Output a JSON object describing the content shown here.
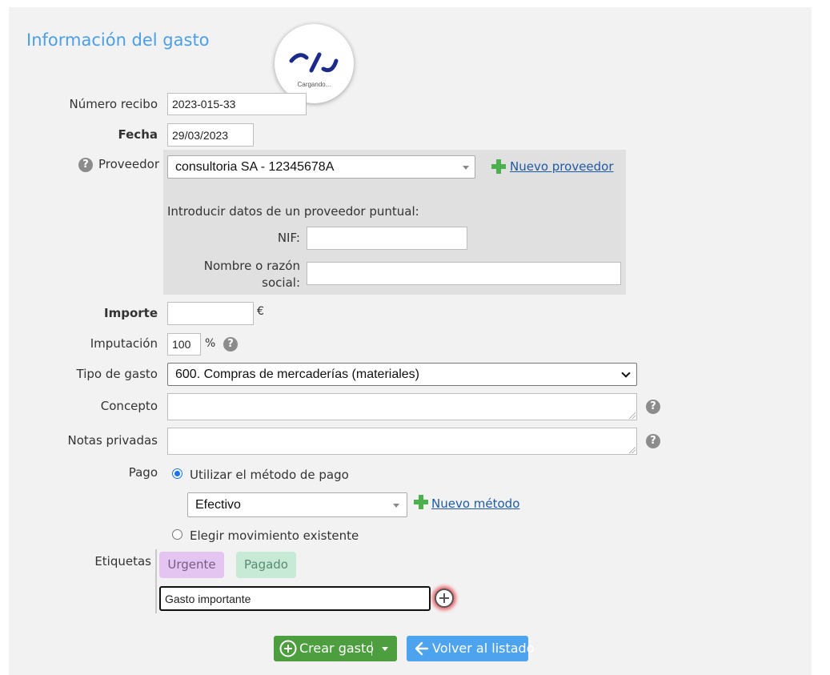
{
  "page": {
    "title": "Información del gasto"
  },
  "loader": {
    "text": "Cargando..."
  },
  "form": {
    "receipt": {
      "label": "Número recibo",
      "value": "2023-015-33"
    },
    "date": {
      "label": "Fecha",
      "value": "29/03/2023"
    },
    "supplier": {
      "label": "Proveedor",
      "selected": "consultoria SA - 12345678A",
      "new_link": "Nuevo proveedor",
      "one_off_heading": "Introducir datos de un proveedor puntual:",
      "nif_label": "NIF:",
      "nif_value": "",
      "name_label_line1": "Nombre o razón",
      "name_label_line2": "social:",
      "name_value": ""
    },
    "amount": {
      "label": "Importe",
      "value": "",
      "unit": "€"
    },
    "imputation": {
      "label": "Imputación",
      "value": "100",
      "unit": "%"
    },
    "expense_type": {
      "label": "Tipo de gasto",
      "selected": "600. Compras de mercaderías (materiales)"
    },
    "concept": {
      "label": "Concepto",
      "value": ""
    },
    "private_notes": {
      "label": "Notas privadas",
      "value": ""
    },
    "payment": {
      "label": "Pago",
      "option_method": "Utilizar el método de pago",
      "method_selected": "Efectivo",
      "new_method_link": "Nuevo método",
      "option_existing": "Elegir movimiento existente",
      "selected_option": "method"
    },
    "tags": {
      "label": "Etiquetas",
      "items": [
        {
          "label": "Urgente",
          "bg": "#e4c4f0",
          "fg": "#7a5a8a"
        },
        {
          "label": "Pagado",
          "bg": "#c6ead6",
          "fg": "#5c8a6e"
        }
      ],
      "new_tag_value": "Gasto importante"
    }
  },
  "actions": {
    "create_label": "Crear gasto",
    "back_label": "Volver al listado"
  },
  "colors": {
    "accent": "#4a9fe8",
    "create_button": "#4d9e3f",
    "back_button": "#4da3ee",
    "plus_green": "#4caf50"
  }
}
